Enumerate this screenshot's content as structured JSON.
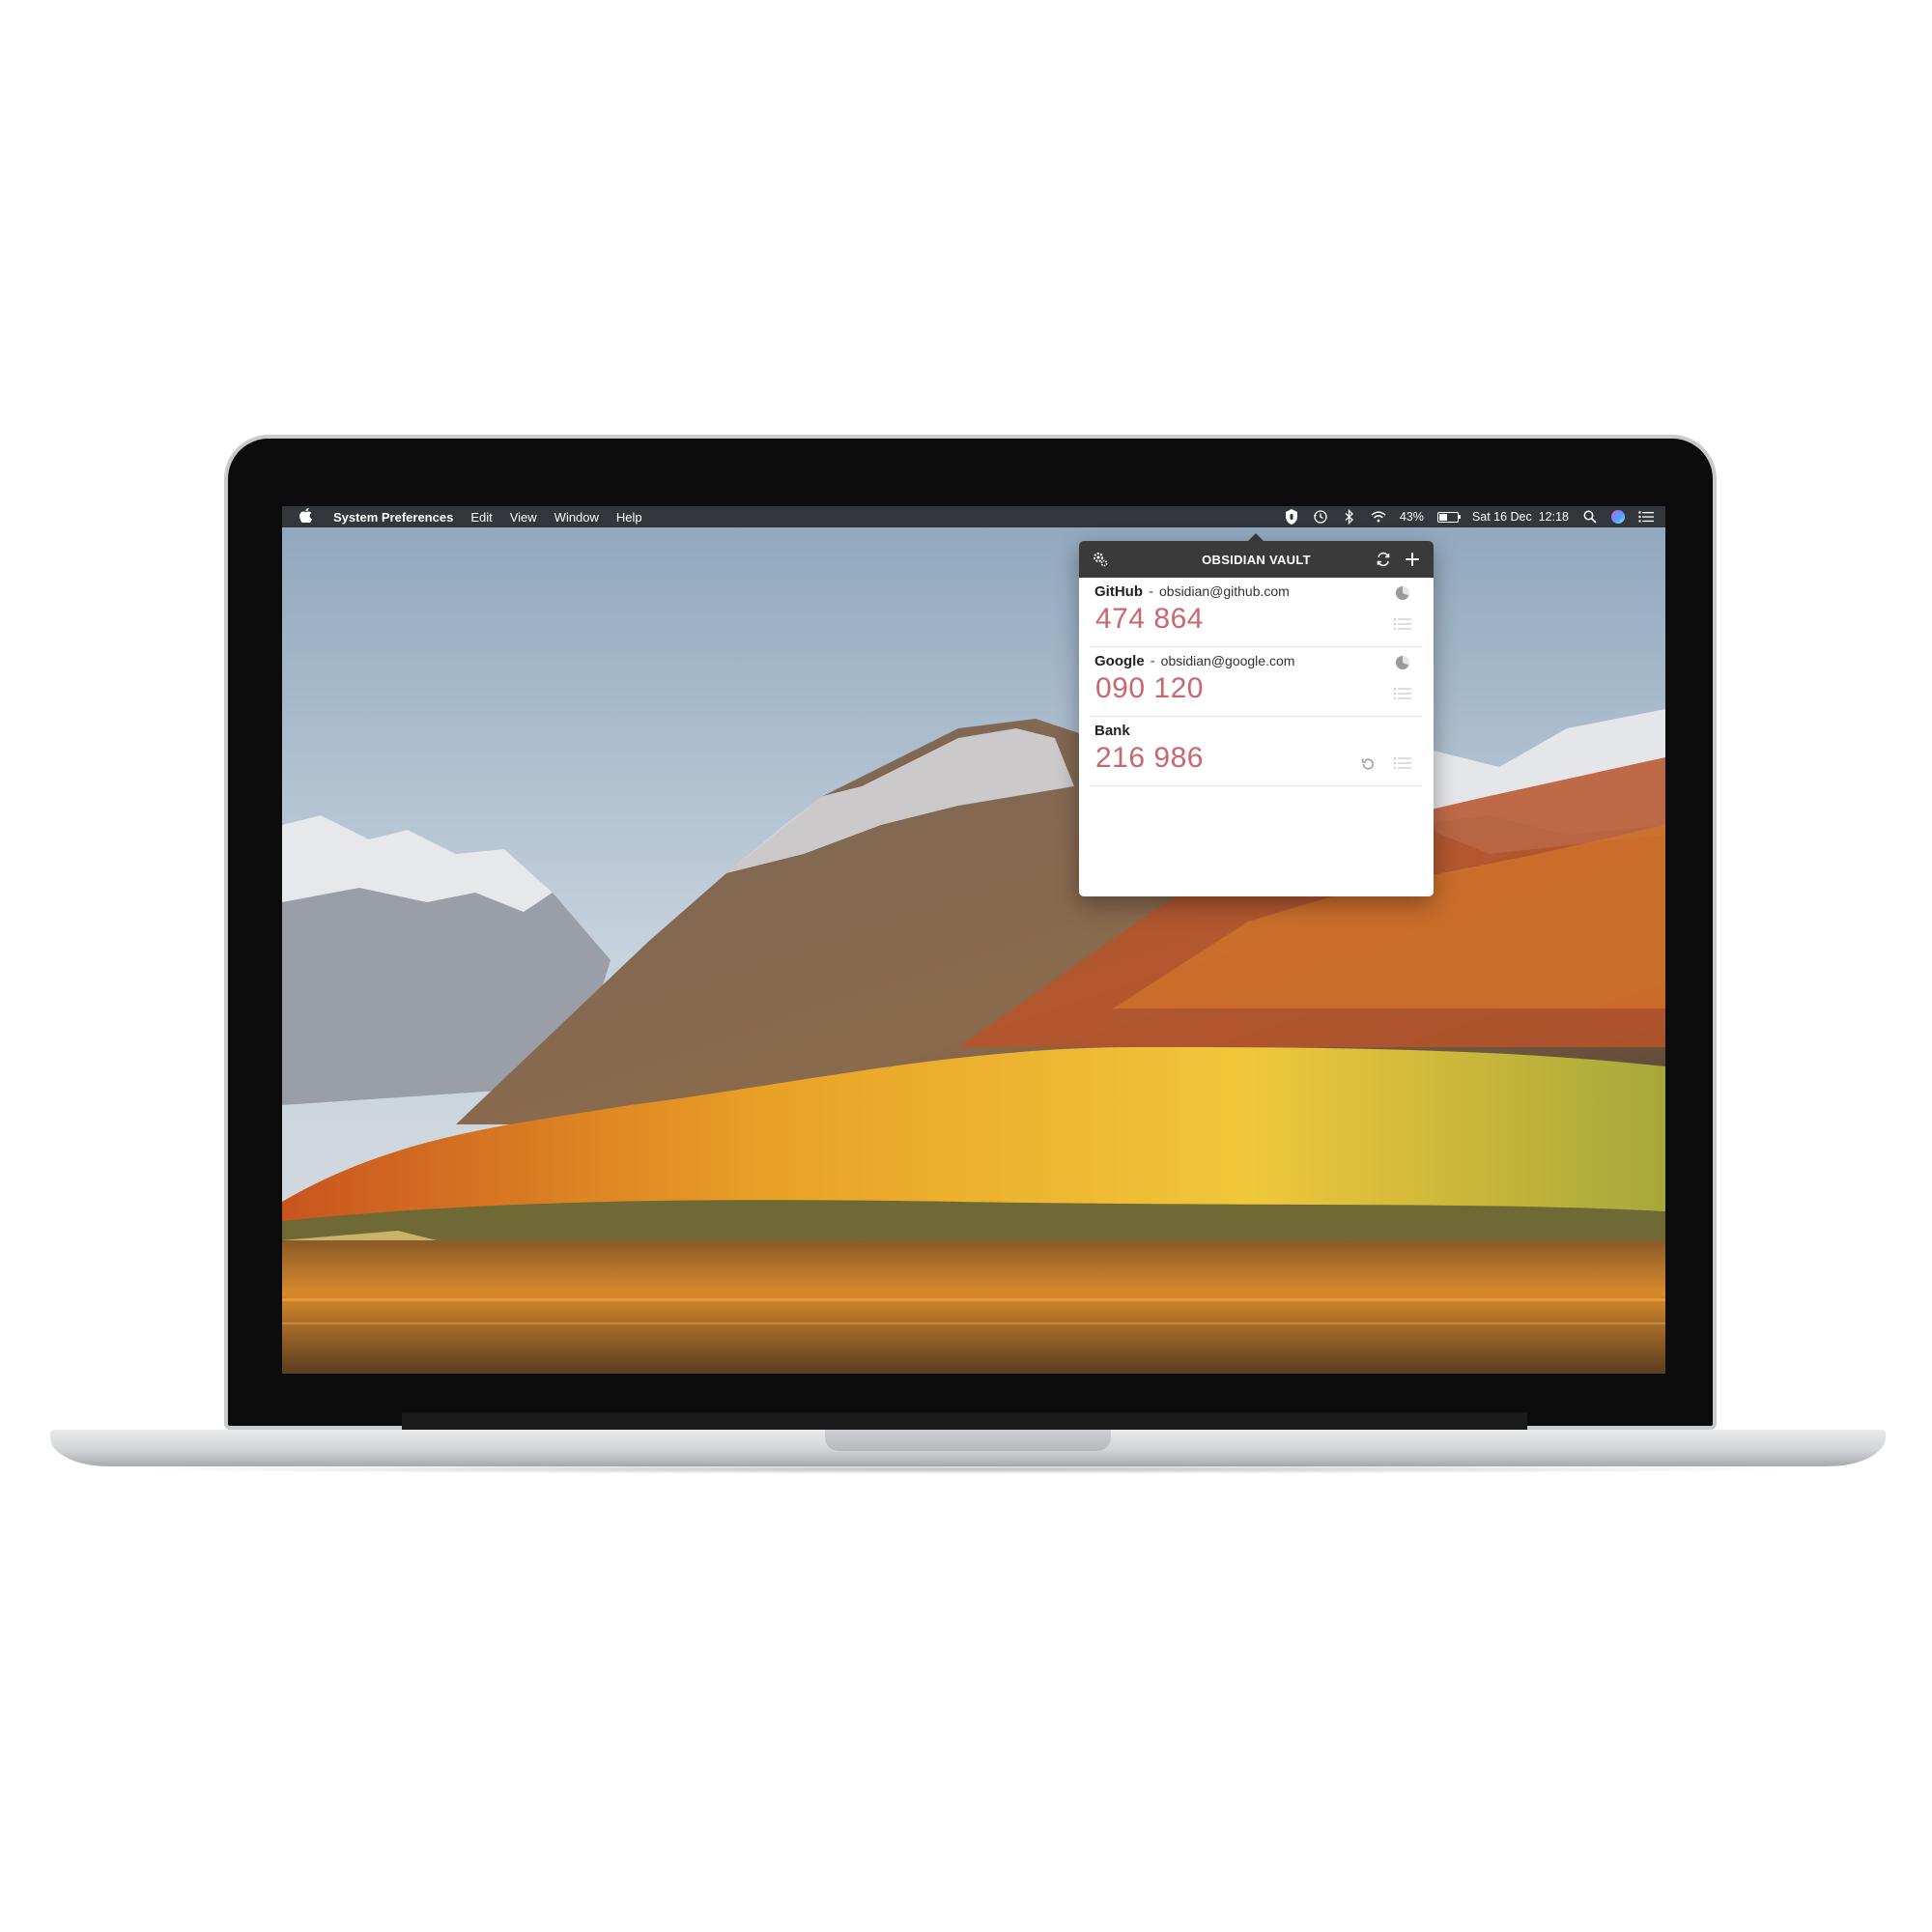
{
  "menubar": {
    "apple": "",
    "app_name": "System Preferences",
    "menus": [
      "Edit",
      "View",
      "Window",
      "Help"
    ],
    "battery_percent": "43%",
    "battery_level": 0.43,
    "datetime": "Sat 16 Dec  12:18",
    "status_icons": [
      "obsidian-vault-icon",
      "time-machine-icon",
      "bluetooth-icon",
      "wifi-icon",
      "battery-icon",
      "spotlight-icon",
      "siri-icon",
      "notification-center-icon"
    ]
  },
  "popover": {
    "title": "OBSIDIAN VAULT",
    "header_icons": [
      "settings-gear-icon",
      "sync-icon",
      "add-icon"
    ],
    "accounts": [
      {
        "name": "GitHub",
        "separator": "-",
        "email": "obsidian@github.com",
        "code": "474 864",
        "type": "totp",
        "timer_icon": "timer-pie-icon"
      },
      {
        "name": "Google",
        "separator": "-",
        "email": "obsidian@google.com",
        "code": "090 120",
        "type": "totp",
        "timer_icon": "timer-pie-icon"
      },
      {
        "name": "Bank",
        "separator": "",
        "email": "",
        "code": "216 986",
        "type": "hotp",
        "timer_icon": "refresh-counter-icon"
      }
    ]
  },
  "colors": {
    "code_color": "#c9676f",
    "header_bg": "#3a3a3a",
    "menubar_bg": "#1e1e1e"
  }
}
